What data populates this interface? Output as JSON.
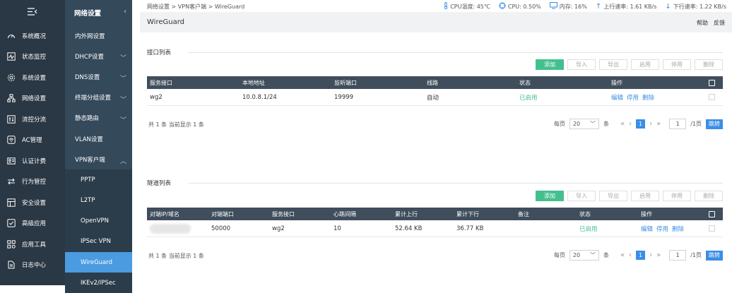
{
  "nav1": {
    "items": [
      {
        "label": "系统概况",
        "icon": "dashboard-icon"
      },
      {
        "label": "状态监控",
        "icon": "monitor-icon"
      },
      {
        "label": "系统设置",
        "icon": "gear-icon"
      },
      {
        "label": "网络设置",
        "icon": "network-icon"
      },
      {
        "label": "流控分流",
        "icon": "sliders-icon"
      },
      {
        "label": "AC管理",
        "icon": "wifi-icon"
      },
      {
        "label": "认证计费",
        "icon": "id-card-icon"
      },
      {
        "label": "行为管控",
        "icon": "arrows-icon"
      },
      {
        "label": "安全设置",
        "icon": "shield-icon"
      },
      {
        "label": "高级应用",
        "icon": "check-box-icon"
      },
      {
        "label": "应用工具",
        "icon": "apps-icon"
      },
      {
        "label": "日志中心",
        "icon": "document-icon"
      }
    ]
  },
  "nav2": {
    "title": "网络设置",
    "items": [
      {
        "label": "内外网设置"
      },
      {
        "label": "DHCP设置"
      },
      {
        "label": "DNS设置"
      },
      {
        "label": "终端分组设置"
      },
      {
        "label": "静态路由"
      },
      {
        "label": "VLAN设置"
      },
      {
        "label": "VPN客户端"
      },
      {
        "label": "PPTP"
      },
      {
        "label": "L2TP"
      },
      {
        "label": "OpenVPN"
      },
      {
        "label": "IPSec VPN"
      },
      {
        "label": "WireGuard"
      },
      {
        "label": "IKEv2/IPSec"
      }
    ]
  },
  "topbar": {
    "breadcrumb": "网络设置 > VPN客户端 > WireGuard",
    "cpu_temp": "CPU温度: 45℃",
    "cpu": "CPU: 0.50%",
    "mem": "内存: 16%",
    "up": "上行速率: 1.61 KB/s",
    "down": "下行速率: 1.22 KB/s"
  },
  "title": "WireGuard",
  "help": "帮助",
  "feedback": "反馈",
  "buttons": {
    "add": "添加",
    "import": "导入",
    "export": "导出",
    "enable": "启用",
    "disable": "停用",
    "delete": "删除"
  },
  "iface": {
    "title": "接口列表",
    "headers": [
      "服务接口",
      "本地地址",
      "监听端口",
      "线路",
      "状态",
      "操作"
    ],
    "row": {
      "name": "wg2",
      "addr": "10.0.8.1/24",
      "port": "19999",
      "line": "自动",
      "status": "已启用",
      "edit": "编辑",
      "stop": "停用",
      "del": "删除"
    },
    "summary": "共 1 条 当前显示 1 条"
  },
  "tunnel": {
    "title": "隧道列表",
    "headers": [
      "对端IP/域名",
      "对端端口",
      "服务接口",
      "心跳间隔",
      "累计上行",
      "累计下行",
      "备注",
      "状态",
      "操作"
    ],
    "row": {
      "peer": "",
      "port": "50000",
      "iface": "wg2",
      "hb": "10",
      "up": "52.64 KB",
      "down": "36.77 KB",
      "note": "",
      "status": "已启用",
      "edit": "编辑",
      "stop": "停用",
      "del": "删除"
    },
    "summary": "共 1 条 当前显示 1 条"
  },
  "pager": {
    "per_page": "每页",
    "size": "20",
    "unit": "条",
    "current": "1",
    "page_input": "1",
    "total": "/1页",
    "go": "跳转"
  }
}
